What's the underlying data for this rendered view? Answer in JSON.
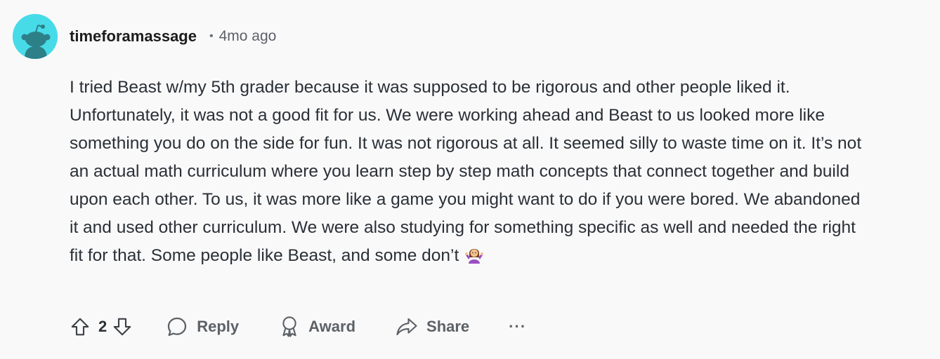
{
  "comment": {
    "username": "timeforamassage",
    "separator": "•",
    "timestamp": "4mo ago",
    "body": "I tried Beast w/my 5th grader because it was supposed to be rigorous and other people liked it. Unfortunately, it was not a good fit for us. We were working ahead and Beast to us looked more like something you do on the side for fun. It was not rigorous at all. It seemed silly to waste time on it. It’s not an actual math curriculum where you learn step by step math concepts that connect together and build upon each other. To us, it was more like a game you might want to do if you were bored. We abandoned it and used other curriculum. We were also studying for something specific as well and needed the right fit for that. Some people like Beast, and some don’t",
    "body_emoji": "woman-shrugging-emoji",
    "avatar_color": "#47dbe8"
  },
  "actions": {
    "vote_count": "2",
    "reply_label": "Reply",
    "award_label": "Award",
    "share_label": "Share",
    "more_label": "···"
  },
  "icons": {
    "upvote": "upvote-arrow-icon",
    "downvote": "downvote-arrow-icon",
    "reply": "speech-bubble-icon",
    "award": "award-ribbon-icon",
    "share": "share-arrow-icon",
    "more": "ellipsis-icon"
  }
}
